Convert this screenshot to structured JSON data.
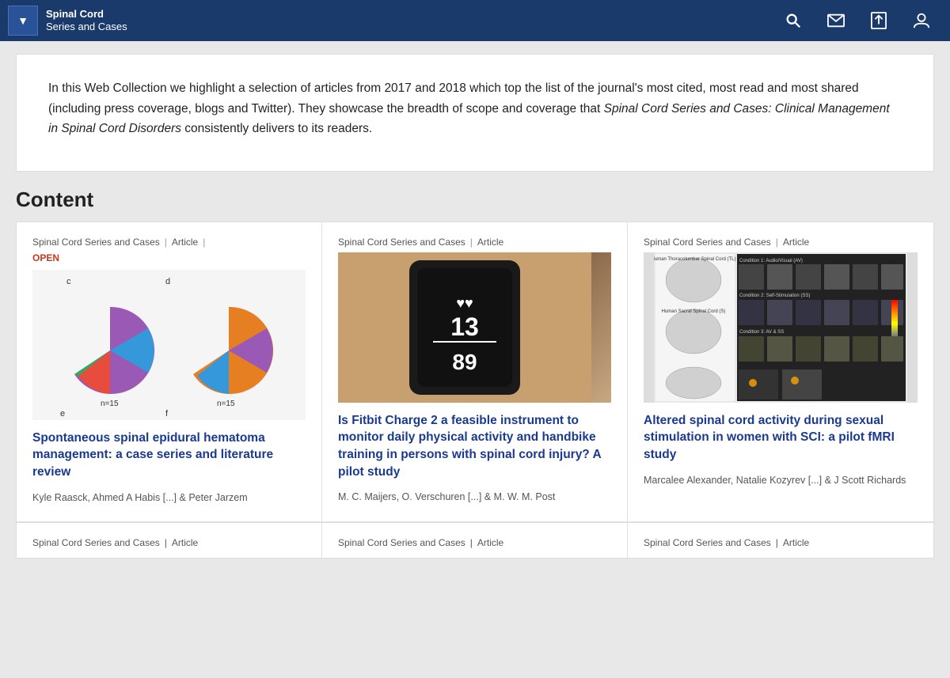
{
  "header": {
    "brand_line1": "Spinal Cord",
    "brand_line2": "Series and Cases",
    "dropdown_icon": "▼",
    "icons": [
      {
        "name": "search-icon",
        "glyph": "🔍"
      },
      {
        "name": "mail-icon",
        "glyph": "✉"
      },
      {
        "name": "upload-icon",
        "glyph": "⬆"
      },
      {
        "name": "user-icon",
        "glyph": "👤"
      }
    ]
  },
  "intro": {
    "text_part1": "In this Web Collection we highlight a selection of articles from 2017 and 2018 which top the list of the journal's most cited, most read and most shared (including press coverage, blogs and Twitter). They showcase the breadth of scope and coverage that ",
    "journal_italic": "Spinal Cord Series and Cases: Clinical Management in Spinal Cord Disorders",
    "text_part2": " consistently delivers to its readers."
  },
  "content": {
    "heading": "Content",
    "articles": [
      {
        "journal": "Spinal Cord Series and Cases",
        "type": "Article",
        "open": true,
        "open_label": "OPEN",
        "title": "Spontaneous spinal epidural hematoma management: a case series and literature review",
        "authors": "Kyle Raasck, Ahmed A Habis [...] & Peter Jarzem",
        "has_pie_chart": true
      },
      {
        "journal": "Spinal Cord Series and Cases",
        "type": "Article",
        "open": false,
        "title": "Is Fitbit Charge 2 a feasible instrument to monitor daily physical activity and handbike training in persons with spinal cord injury? A pilot study",
        "authors": "M. C. Maijers, O. Verschuren [...] & M. W. M. Post",
        "has_fitbit": true,
        "fitbit_number1": "13",
        "fitbit_number2": "89"
      },
      {
        "journal": "Spinal Cord Series and Cases",
        "type": "Article",
        "open": false,
        "title": "Altered spinal cord activity during sexual stimulation in women with SCI: a pilot fMRI study",
        "authors": "Marcalee Alexander, Natalie Kozyrev [...] & J Scott Richards",
        "has_mri": true
      }
    ],
    "bottom_stubs": [
      {
        "journal": "Spinal Cord Series and Cases",
        "type": "Article"
      },
      {
        "journal": "Spinal Cord Series and Cases",
        "type": "Article"
      },
      {
        "journal": "Spinal Cord Series and Cases",
        "type": "Article"
      }
    ]
  }
}
